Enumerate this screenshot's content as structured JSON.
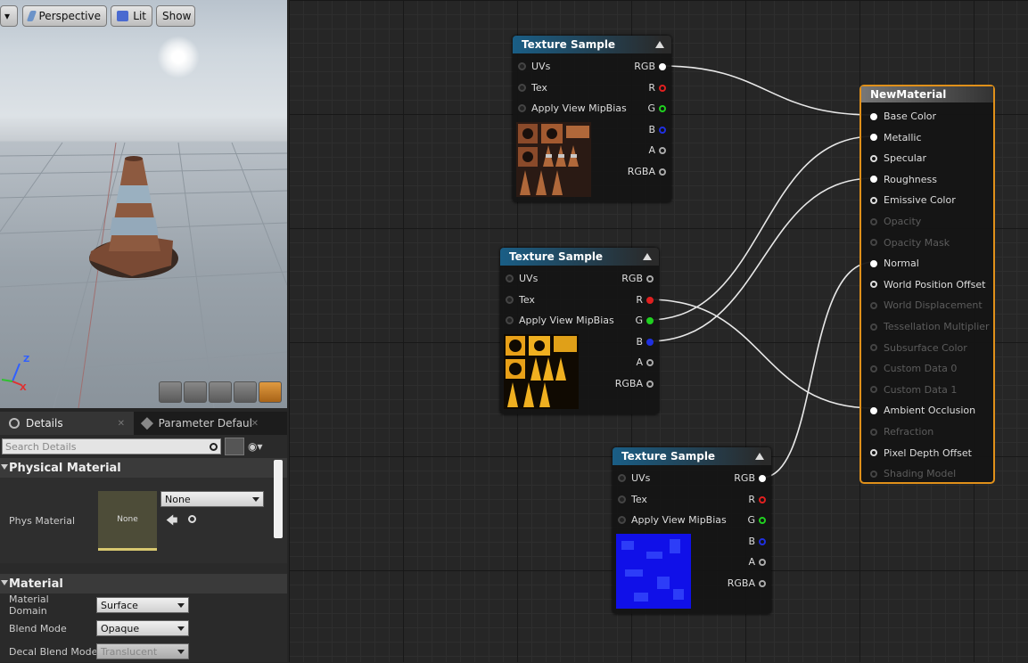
{
  "viewport": {
    "dropdown_glyph": "▾",
    "perspective_label": "Perspective",
    "lit_label": "Lit",
    "show_label": "Show",
    "axis_z": "Z",
    "axis_x": "X"
  },
  "details": {
    "tabs": [
      {
        "label": "Details",
        "close": "✕"
      },
      {
        "label": "Parameter Defaults",
        "close": "✕"
      }
    ],
    "search_placeholder": "Search Details",
    "sections": {
      "physical_material": "Physical Material",
      "material": "Material"
    },
    "phys_material_label": "Phys Material",
    "phys_material_thumb": "None",
    "phys_material_value": "None",
    "properties": [
      {
        "label": "Material Domain",
        "value": "Surface"
      },
      {
        "label": "Blend Mode",
        "value": "Opaque"
      },
      {
        "label": "Decal Blend Mode",
        "value": "Translucent"
      }
    ]
  },
  "graph": {
    "texture_nodes": [
      {
        "title": "Texture Sample",
        "inputs": [
          "UVs",
          "Tex",
          "Apply View MipBias"
        ],
        "outputs": [
          "RGB",
          "R",
          "G",
          "B",
          "A",
          "RGBA"
        ]
      },
      {
        "title": "Texture Sample",
        "inputs": [
          "UVs",
          "Tex",
          "Apply View MipBias"
        ],
        "outputs": [
          "RGB",
          "R",
          "G",
          "B",
          "A",
          "RGBA"
        ]
      },
      {
        "title": "Texture Sample",
        "inputs": [
          "UVs",
          "Tex",
          "Apply View MipBias"
        ],
        "outputs": [
          "RGB",
          "R",
          "G",
          "B",
          "A",
          "RGBA"
        ]
      }
    ],
    "material_node": {
      "title": "NewMaterial",
      "inputs": [
        {
          "label": "Base Color",
          "state": "connected"
        },
        {
          "label": "Metallic",
          "state": "connected"
        },
        {
          "label": "Specular",
          "state": "open"
        },
        {
          "label": "Roughness",
          "state": "connected"
        },
        {
          "label": "Emissive Color",
          "state": "open"
        },
        {
          "label": "Opacity",
          "state": "disabled"
        },
        {
          "label": "Opacity Mask",
          "state": "disabled"
        },
        {
          "label": "Normal",
          "state": "connected"
        },
        {
          "label": "World Position Offset",
          "state": "open"
        },
        {
          "label": "World Displacement",
          "state": "disabled"
        },
        {
          "label": "Tessellation Multiplier",
          "state": "disabled"
        },
        {
          "label": "Subsurface Color",
          "state": "disabled"
        },
        {
          "label": "Custom Data 0",
          "state": "disabled"
        },
        {
          "label": "Custom Data 1",
          "state": "disabled"
        },
        {
          "label": "Ambient Occlusion",
          "state": "connected"
        },
        {
          "label": "Refraction",
          "state": "disabled"
        },
        {
          "label": "Pixel Depth Offset",
          "state": "open"
        },
        {
          "label": "Shading Model",
          "state": "disabled"
        }
      ]
    },
    "colors": {
      "r_pin": "#e02020",
      "g_pin": "#20d020",
      "b_pin": "#2030e0",
      "white_pin": "#ffffff",
      "node_header": "#1a5e86",
      "material_border": "#e0901a"
    }
  }
}
